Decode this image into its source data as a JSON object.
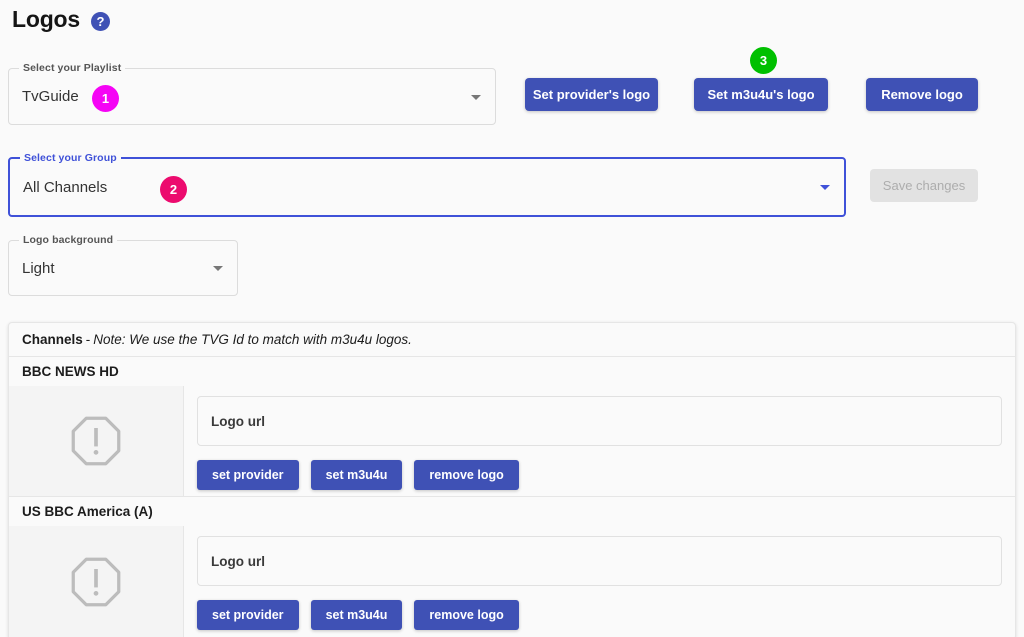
{
  "header": {
    "title": "Logos",
    "help_icon_label": "?"
  },
  "form": {
    "playlist": {
      "legend": "Select your Playlist",
      "value": "TvGuide",
      "badge": "1"
    },
    "group": {
      "legend": "Select your Group",
      "value": "All Channels",
      "badge": "2"
    },
    "logo_background": {
      "legend": "Logo background",
      "value": "Light"
    }
  },
  "actions": {
    "set_provider_logo": "Set provider's logo",
    "set_m3u4u_logo": "Set m3u4u's logo",
    "set_m3u4u_badge": "3",
    "remove_logo": "Remove logo",
    "save_changes": "Save changes"
  },
  "panel": {
    "header_label": "Channels",
    "header_dash": "-",
    "header_note": "Note: We use the TVG Id to match with m3u4u logos.",
    "url_placeholder": "Logo url",
    "row_buttons": {
      "set_provider": "set provider",
      "set_m3u4u": "set m3u4u",
      "remove_logo": "remove logo"
    },
    "channels": [
      {
        "name": "BBC NEWS HD",
        "logo_url": ""
      },
      {
        "name": "US BBC America (A)",
        "logo_url": ""
      }
    ]
  },
  "colors": {
    "accent_blue": "#3f51b5",
    "focus_blue": "#3f51d8",
    "badge_1": "#f504f5",
    "badge_2": "#ec0b6e",
    "badge_3": "#00c000",
    "page_bg": "#fafafa"
  }
}
